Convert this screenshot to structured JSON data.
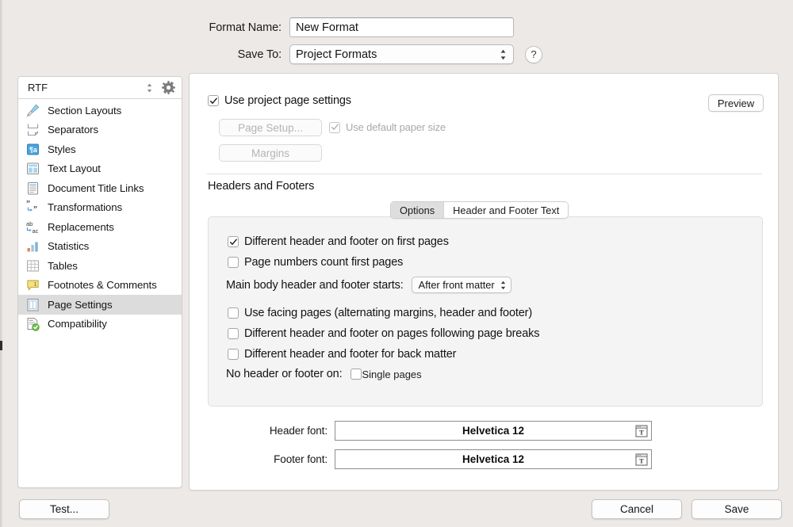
{
  "window": {
    "format_name_label": "Format Name:",
    "format_name_value": "New Format",
    "save_to_label": "Save To:",
    "save_to_value": "Project Formats",
    "help_label": "?"
  },
  "sidebar": {
    "header_title": "RTF",
    "items": [
      {
        "label": "Section Layouts",
        "icon": "paintbrush-icon",
        "selected": false
      },
      {
        "label": "Separators",
        "icon": "separators-icon",
        "selected": false
      },
      {
        "label": "Styles",
        "icon": "styles-icon",
        "selected": false
      },
      {
        "label": "Text Layout",
        "icon": "text-layout-icon",
        "selected": false
      },
      {
        "label": "Document Title Links",
        "icon": "document-title-links-icon",
        "selected": false
      },
      {
        "label": "Transformations",
        "icon": "transformations-icon",
        "selected": false
      },
      {
        "label": "Replacements",
        "icon": "replacements-icon",
        "selected": false
      },
      {
        "label": "Statistics",
        "icon": "statistics-icon",
        "selected": false
      },
      {
        "label": "Tables",
        "icon": "tables-icon",
        "selected": false
      },
      {
        "label": "Footnotes & Comments",
        "icon": "footnotes-comments-icon",
        "selected": false
      },
      {
        "label": "Page Settings",
        "icon": "page-settings-icon",
        "selected": true
      },
      {
        "label": "Compatibility",
        "icon": "compatibility-icon",
        "selected": false
      }
    ]
  },
  "main": {
    "use_project_page_settings": {
      "label": "Use project page settings",
      "checked": true
    },
    "page_setup_button": "Page Setup...",
    "use_default_paper_size": {
      "label": "Use default paper size",
      "checked": true,
      "disabled": true
    },
    "margins_button": "Margins",
    "preview_button": "Preview",
    "headers_footers_title": "Headers and Footers",
    "tabs": [
      {
        "label": "Options",
        "active": true
      },
      {
        "label": "Header and Footer Text",
        "active": false
      }
    ],
    "options": {
      "different_first_pages": {
        "label": "Different header and footer on first pages",
        "checked": true
      },
      "page_numbers_count_first": {
        "label": "Page numbers count first pages",
        "checked": false
      },
      "main_body_starts_label": "Main body header and footer starts:",
      "main_body_starts_value": "After front matter",
      "facing_pages": {
        "label": "Use facing pages (alternating margins, header and footer)",
        "checked": false
      },
      "after_page_breaks": {
        "label": "Different header and footer on pages following page breaks",
        "checked": false
      },
      "back_matter": {
        "label": "Different header and footer for back matter",
        "checked": false
      },
      "no_header_footer_label": "No header or footer on:",
      "single_pages": {
        "label": "Single pages",
        "checked": false
      }
    },
    "header_font_label": "Header font:",
    "header_font_value": "Helvetica 12",
    "footer_font_label": "Footer font:",
    "footer_font_value": "Helvetica 12"
  },
  "footer": {
    "test_button": "Test...",
    "cancel_button": "Cancel",
    "save_button": "Save"
  },
  "colors": {
    "window_bg": "#ece9e6",
    "panel_bg": "#ffffff",
    "selection": "#dcdcdc",
    "options_bg": "#f4f4f4"
  }
}
